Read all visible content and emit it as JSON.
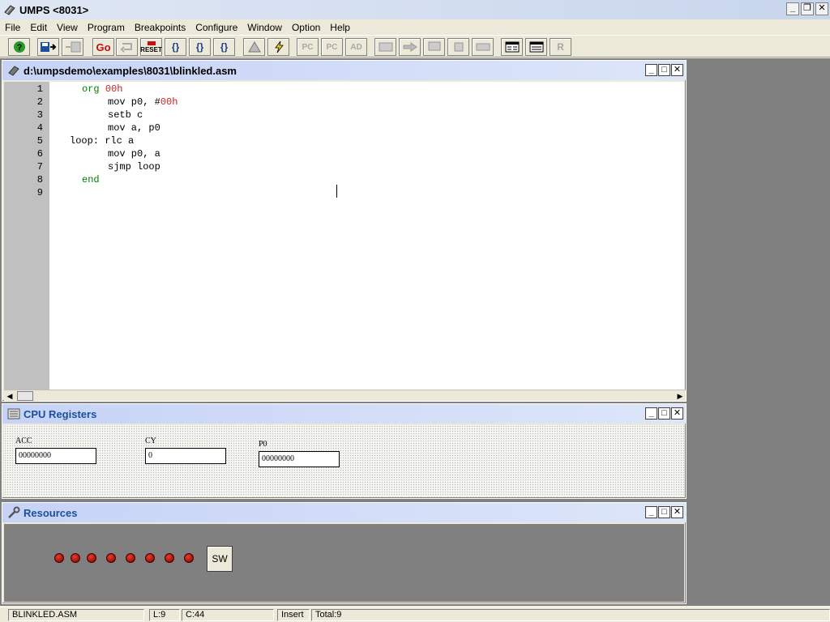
{
  "app": {
    "title": "UMPS <8031>",
    "window_buttons": {
      "minimize": "_",
      "restore": "❐",
      "close": "✕"
    }
  },
  "menu": [
    "File",
    "Edit",
    "View",
    "Program",
    "Breakpoints",
    "Configure",
    "Window",
    "Option",
    "Help"
  ],
  "toolbar": {
    "go": "Go",
    "reset": "RESET",
    "step_into": "{}",
    "step_over": "{}",
    "step_out": "{}",
    "pc1": "PC",
    "pc2": "PC",
    "ad": "AD",
    "r": "R"
  },
  "editor": {
    "title": "d:\\umpsdemo\\examples\\8031\\blinkled.asm",
    "line_numbers": [
      "1",
      "2",
      "3",
      "4",
      "5",
      "6",
      "7",
      "8",
      "9"
    ],
    "lines": [
      {
        "indent": "    ",
        "kw": "org ",
        "num": "00h",
        "rest": ""
      },
      {
        "indent": "        ",
        "kw": "",
        "num": "",
        "rest": "mov p0, #",
        "num2": "00h"
      },
      {
        "indent": "        ",
        "kw": "",
        "num": "",
        "rest": "setb c"
      },
      {
        "indent": "        ",
        "kw": "",
        "num": "",
        "rest": "mov a, p0"
      },
      {
        "indent": "  ",
        "kw": "",
        "num": "",
        "rest": "loop: rlc a"
      },
      {
        "indent": "        ",
        "kw": "",
        "num": "",
        "rest": "mov p0, a"
      },
      {
        "indent": "        ",
        "kw": "",
        "num": "",
        "rest": "sjmp loop"
      },
      {
        "indent": "    ",
        "kw": "end",
        "num": "",
        "rest": ""
      }
    ],
    "scroll_left": "◀",
    "scroll_right": "▶"
  },
  "registers": {
    "title": "CPU Registers",
    "acc_label": "ACC",
    "acc_value": "00000000",
    "cy_label": "CY",
    "cy_value": "0",
    "p0_label": "P0",
    "p0_value": "00000000"
  },
  "resources": {
    "title": "Resources",
    "led_count": 8,
    "sw_label": "SW"
  },
  "status": {
    "file": "BLINKLED.ASM",
    "line": "L:9",
    "col": "C:44",
    "mode": "Insert",
    "total": "Total:9"
  },
  "colors": {
    "keyword": "#008000",
    "number": "#cc2222",
    "led": "#c02010",
    "mdi_background": "#808080"
  }
}
